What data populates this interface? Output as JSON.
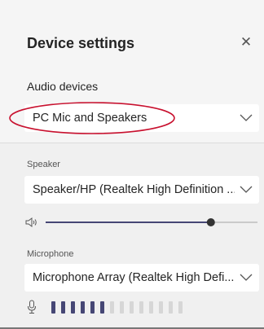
{
  "panel": {
    "title": "Device settings"
  },
  "audio_devices": {
    "heading": "Audio devices",
    "selected": "PC Mic and Speakers"
  },
  "speaker": {
    "label": "Speaker",
    "selected": "Speaker/HP (Realtek High Definition ...",
    "volume": 0.78
  },
  "microphone": {
    "label": "Microphone",
    "selected": "Microphone Array (Realtek High Defi...",
    "level_segments_total": 14,
    "level_segments_active": 6
  },
  "colors": {
    "accent": "#464775",
    "inactive_track": "#bdbdbd",
    "annotation": "#c8102e"
  },
  "icons": {
    "close": "close-icon",
    "dropdown": "chevron-down-icon",
    "speaker": "speaker-icon",
    "microphone": "microphone-icon"
  }
}
